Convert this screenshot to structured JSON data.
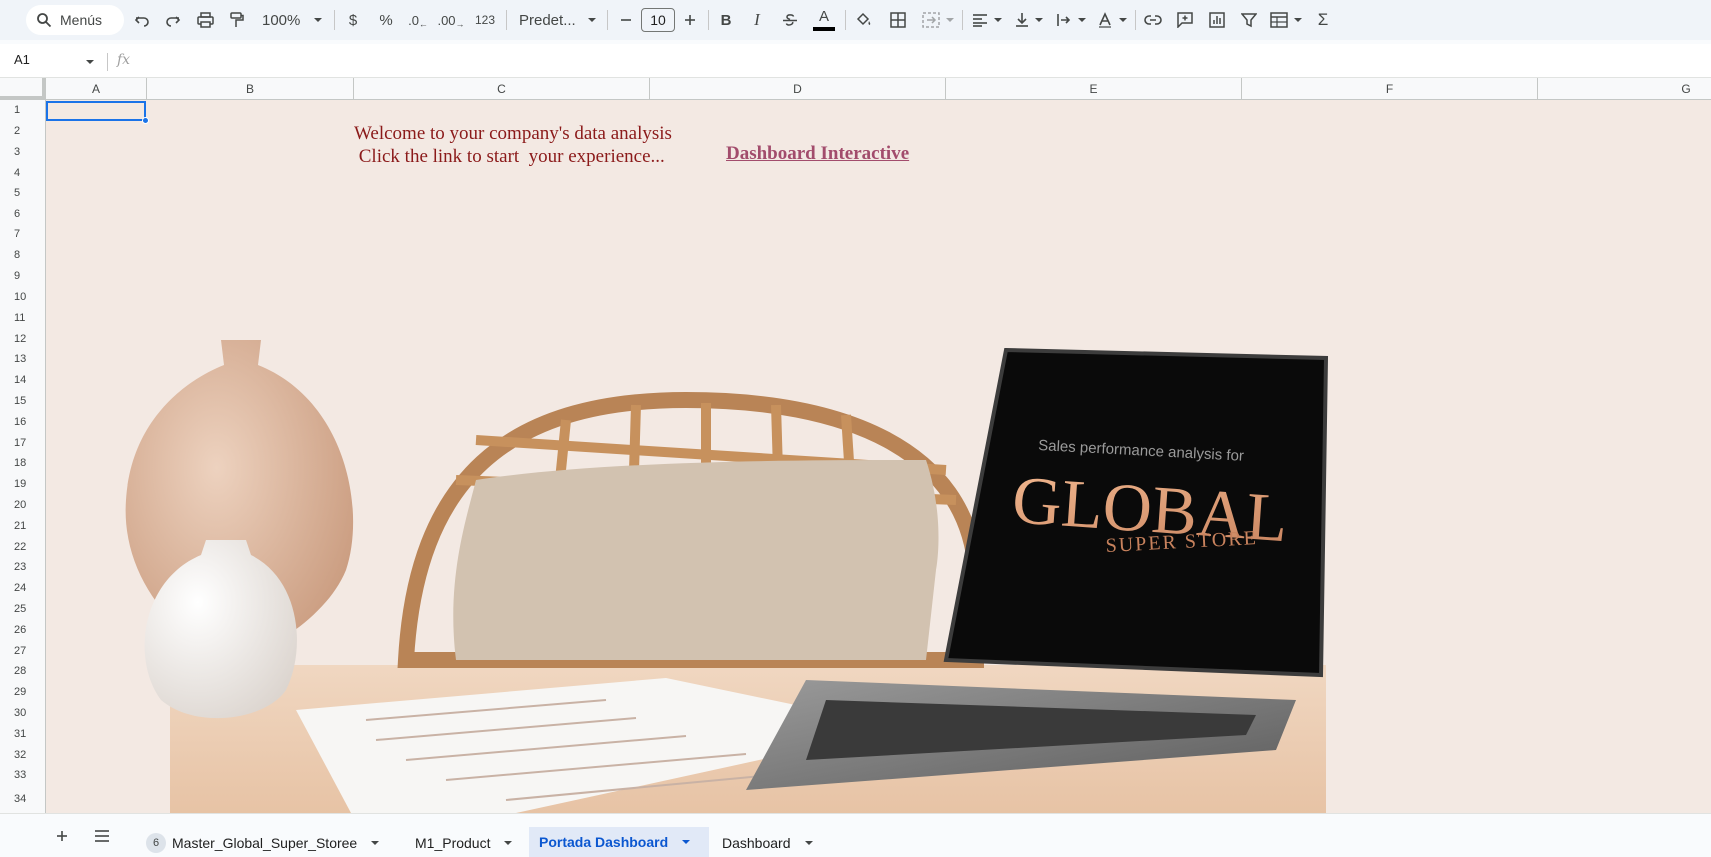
{
  "toolbar": {
    "search_label": "Menús",
    "zoom": "100%",
    "currency": "$",
    "percent": "%",
    "decrease_decimals": ".0",
    "increase_decimals": ".00",
    "number_format": "123",
    "font_name": "Predet...",
    "font_size": "10",
    "bold": "B",
    "italic": "I",
    "text_color_letter": "A"
  },
  "formula_bar": {
    "cell_reference": "A1",
    "fx": "fx"
  },
  "columns": [
    "A",
    "B",
    "C",
    "D",
    "E",
    "F",
    "G"
  ],
  "rows": [
    "1",
    "2",
    "3",
    "4",
    "5",
    "6",
    "7",
    "8",
    "9",
    "10",
    "11",
    "12",
    "13",
    "14",
    "15",
    "16",
    "17",
    "18",
    "19",
    "20",
    "21",
    "22",
    "23",
    "24",
    "25",
    "26",
    "27",
    "28",
    "29",
    "30",
    "31",
    "32",
    "33",
    "34"
  ],
  "sheet": {
    "welcome_line1": "Welcome to your company's data analysis",
    "welcome_line2": " Click the link to start  your experience...",
    "link_text": "Dashboard Interactive",
    "screen_tagline": "Sales performance analysis for",
    "screen_brand": "GLOBAL",
    "screen_sub": "SUPER STORE"
  },
  "tabs": [
    {
      "label": "Master_Global_Super_Storee",
      "badge": "6",
      "active": false
    },
    {
      "label": "M1_Product",
      "active": false
    },
    {
      "label": "Portada Dashboard",
      "active": true
    },
    {
      "label": "Dashboard",
      "active": false
    }
  ],
  "colors": {
    "sheet_background": "#f3e9e3",
    "welcome_text": "#8b1a1a",
    "link": "#a24c6c",
    "selection": "#1a73e8",
    "active_tab": "#0b57d0"
  }
}
